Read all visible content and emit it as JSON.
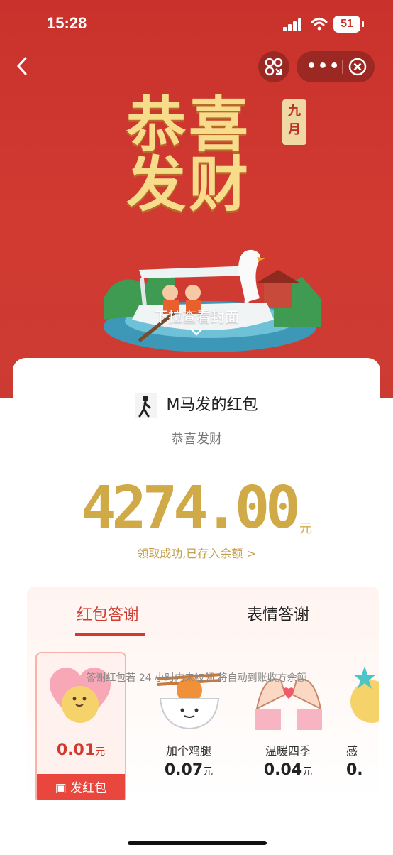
{
  "status_bar": {
    "time": "15:28",
    "battery": "51"
  },
  "cover": {
    "title": "恭喜发财",
    "month": "九月",
    "pull_hint": "下拉查看封面"
  },
  "packet": {
    "sender": "M马发的红包",
    "blessing": "恭喜发财",
    "amount": "4274.00",
    "unit": "元",
    "receipt": "领取成功,已存入余额 >"
  },
  "thanks": {
    "tabs": [
      {
        "label": "红包答谢",
        "active": true
      },
      {
        "label": "表情答谢",
        "active": false
      }
    ],
    "gifts": [
      {
        "name": "",
        "price": "0.01",
        "unit": "元",
        "icon": "heart-hug-icon",
        "selected": true
      },
      {
        "name": "加个鸡腿",
        "price": "0.07",
        "unit": "元",
        "icon": "drumstick-rice-icon"
      },
      {
        "name": "温暖四季",
        "price": "0.04",
        "unit": "元",
        "icon": "heart-hands-icon"
      },
      {
        "name": "感",
        "price": "0.",
        "unit": "",
        "icon": "star-icon"
      }
    ],
    "send_label": "发红包",
    "note": "答谢红包若 24 小时内未被领,将自动到账收方余额"
  },
  "colors": {
    "accent": "#d33a2f",
    "gold": "#d1aa48",
    "cover_red": "#c9322c"
  }
}
